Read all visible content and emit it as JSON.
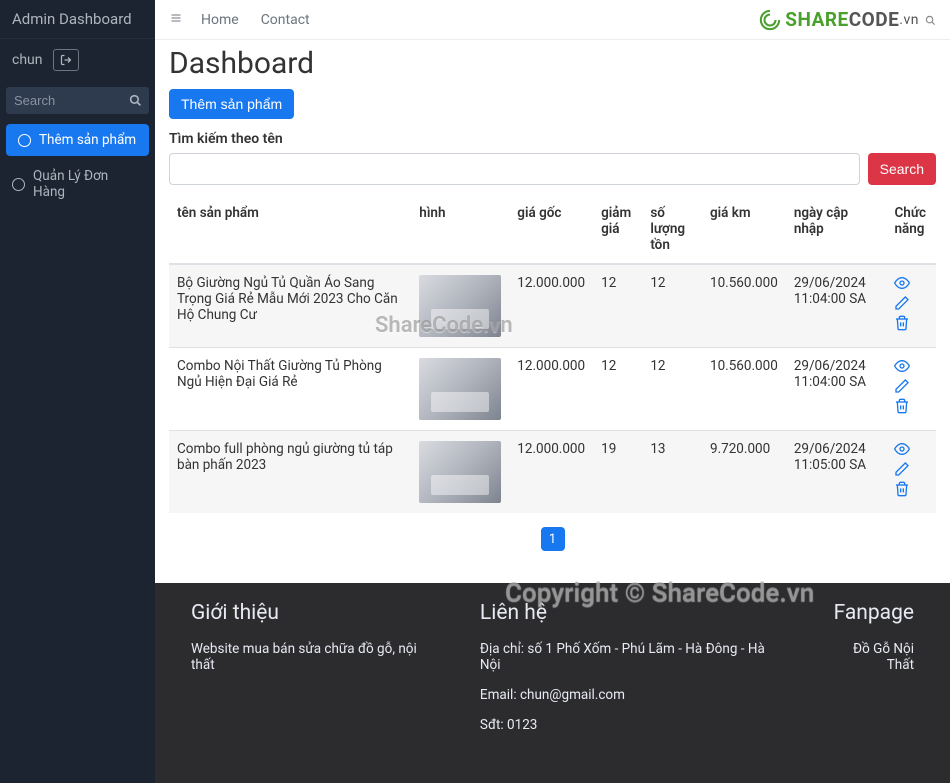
{
  "sidebar": {
    "title": "Admin Dashboard",
    "user": "chun",
    "search_placeholder": "Search",
    "items": [
      {
        "label": "Thêm sản phẩm",
        "active": true
      },
      {
        "label": "Quản Lý Đơn Hàng",
        "active": false
      }
    ]
  },
  "topbar": {
    "links": [
      "Home",
      "Contact"
    ],
    "brand_main": "SHARE",
    "brand_sub": "CODE",
    "brand_tld": ".vn"
  },
  "page": {
    "title": "Dashboard",
    "add_btn": "Thêm sản phẩm",
    "search_label": "Tìm kiếm theo tên",
    "search_btn": "Search"
  },
  "table": {
    "headers": {
      "name": "tên sản phẩm",
      "img": "hình",
      "price": "giá gốc",
      "discount": "giảm giá",
      "stock": "số lượng tồn",
      "km": "giá km",
      "date": "ngày cập nhập",
      "action": "Chức năng"
    },
    "rows": [
      {
        "name": "Bộ Giường Ngủ Tủ Quần Áo Sang Trọng Giá Rẻ Mẫu Mới 2023 Cho Căn Hộ Chung Cư",
        "price": "12.000.000",
        "discount": "12",
        "stock": "12",
        "km": "10.560.000",
        "date": "29/06/2024 11:04:00 SA"
      },
      {
        "name": "Combo Nội Thất Giường Tủ Phòng Ngủ Hiện Đại Giá Rẻ",
        "price": "12.000.000",
        "discount": "12",
        "stock": "12",
        "km": "10.560.000",
        "date": "29/06/2024 11:04:00 SA"
      },
      {
        "name": "Combo full phòng ngủ giường tủ táp bàn phấn 2023",
        "price": "12.000.000",
        "discount": "19",
        "stock": "13",
        "km": "9.720.000",
        "date": "29/06/2024 11:05:00 SA"
      }
    ]
  },
  "pagination": {
    "current": "1"
  },
  "footer": {
    "col1_title": "Giới thiệu",
    "col1_text": "Website mua bán sửa chữa đồ gỗ, nội thất",
    "col2_title": "Liên hệ",
    "col2_addr": "Địa chỉ: số 1 Phố Xốm - Phú Lãm - Hà Đông - Hà Nội",
    "col2_email": "Email: chun@gmail.com",
    "col2_phone": "Sđt: 0123",
    "col3_title": "Fanpage",
    "col3_text": "Đồ Gỗ Nội Thất"
  },
  "watermarks": {
    "w1": "ShareCode.vn",
    "w2": "Copyright © ShareCode.vn"
  }
}
